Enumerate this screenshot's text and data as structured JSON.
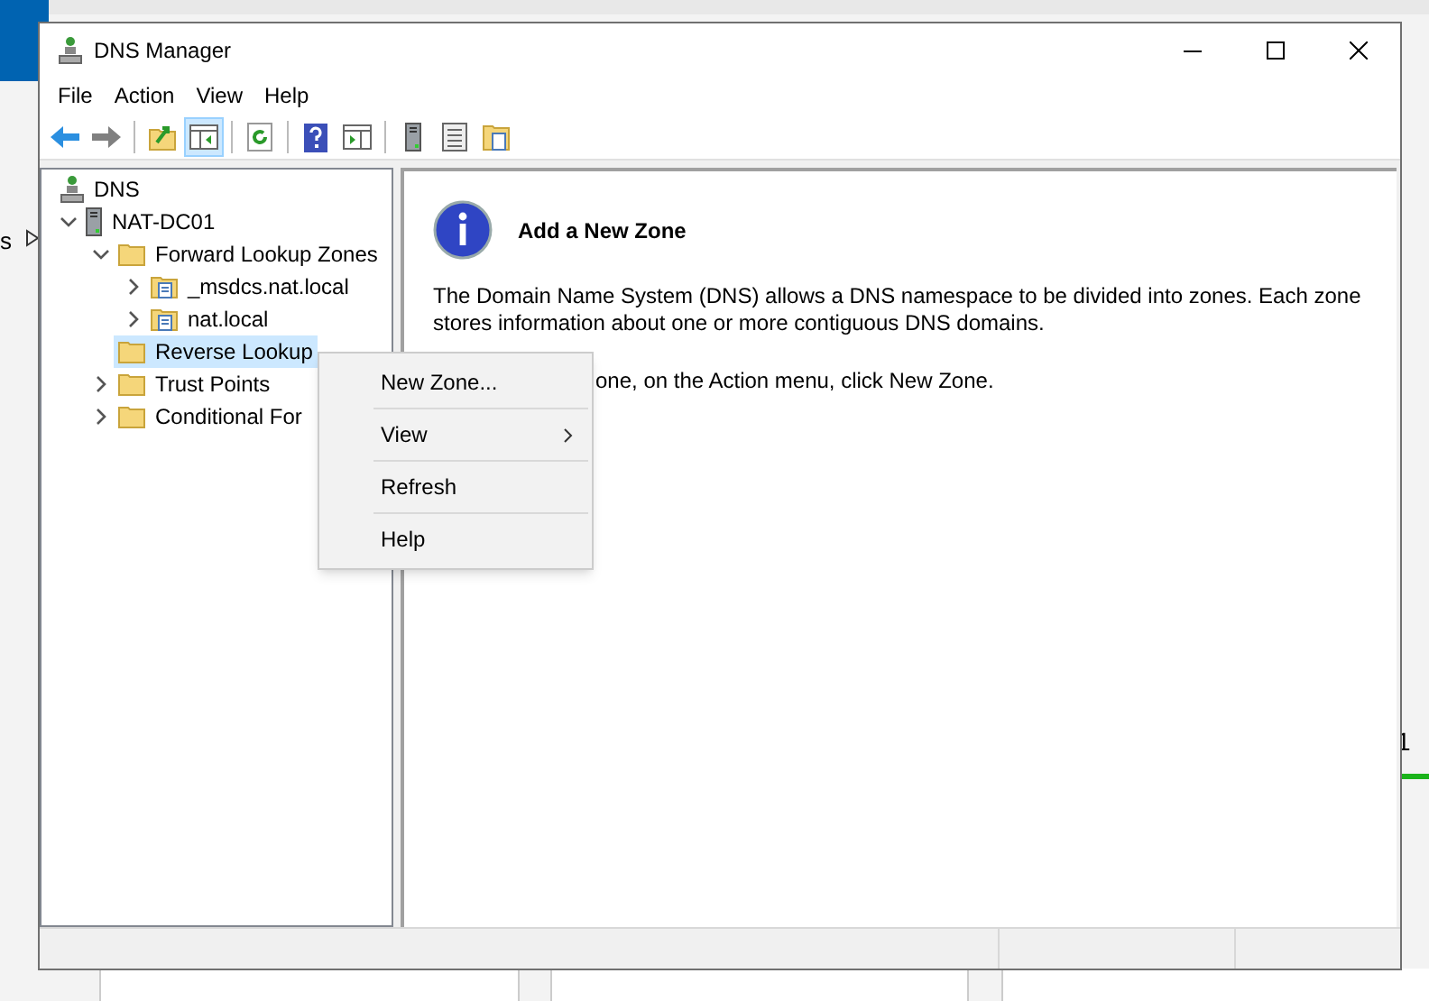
{
  "background": {
    "left_fragment": "s",
    "right_fragment": "1"
  },
  "window": {
    "title": "DNS Manager"
  },
  "menu_bar": [
    "File",
    "Action",
    "View",
    "Help"
  ],
  "toolbar": [
    {
      "kind": "back",
      "pressed": false
    },
    {
      "kind": "forward",
      "pressed": false
    },
    {
      "kind": "sep"
    },
    {
      "kind": "up",
      "pressed": false
    },
    {
      "kind": "tree",
      "pressed": true
    },
    {
      "kind": "sep"
    },
    {
      "kind": "refresh",
      "pressed": false
    },
    {
      "kind": "sep"
    },
    {
      "kind": "help",
      "pressed": false
    },
    {
      "kind": "pane",
      "pressed": false
    },
    {
      "kind": "sep"
    },
    {
      "kind": "server",
      "pressed": false
    },
    {
      "kind": "list",
      "pressed": false
    },
    {
      "kind": "props",
      "pressed": false
    }
  ],
  "tree": [
    {
      "label": "DNS",
      "kind": "dns",
      "selected": false,
      "children": [
        {
          "label": "NAT-DC01",
          "kind": "server",
          "expanded": true,
          "selected": false,
          "children": [
            {
              "label": "Forward Lookup Zones",
              "kind": "folder",
              "expanded": true,
              "selected": false,
              "children": [
                {
                  "label": "_msdcs.nat.local",
                  "kind": "zone",
                  "expanded": false,
                  "selected": false
                },
                {
                  "label": "nat.local",
                  "kind": "zone",
                  "expanded": false,
                  "selected": false
                }
              ]
            },
            {
              "label": "Reverse Lookup",
              "kind": "folder",
              "selected": true
            },
            {
              "label": "Trust Points",
              "kind": "folder",
              "expanded": false,
              "selected": false
            },
            {
              "label": "Conditional For",
              "kind": "folder",
              "expanded": false,
              "selected": false
            }
          ]
        }
      ]
    }
  ],
  "content": {
    "heading": "Add a New Zone",
    "paragraphs": [
      "The Domain Name System (DNS) allows a DNS namespace to be divided into zones. Each zone stores information about one or more contiguous DNS domains.",
      "one, on the Action menu, click New Zone."
    ]
  },
  "context_menu": [
    {
      "label": "New Zone...",
      "submenu": false
    },
    {
      "label": "View",
      "submenu": true
    },
    {
      "label": "Refresh",
      "submenu": false
    },
    {
      "label": "Help",
      "submenu": false
    }
  ]
}
